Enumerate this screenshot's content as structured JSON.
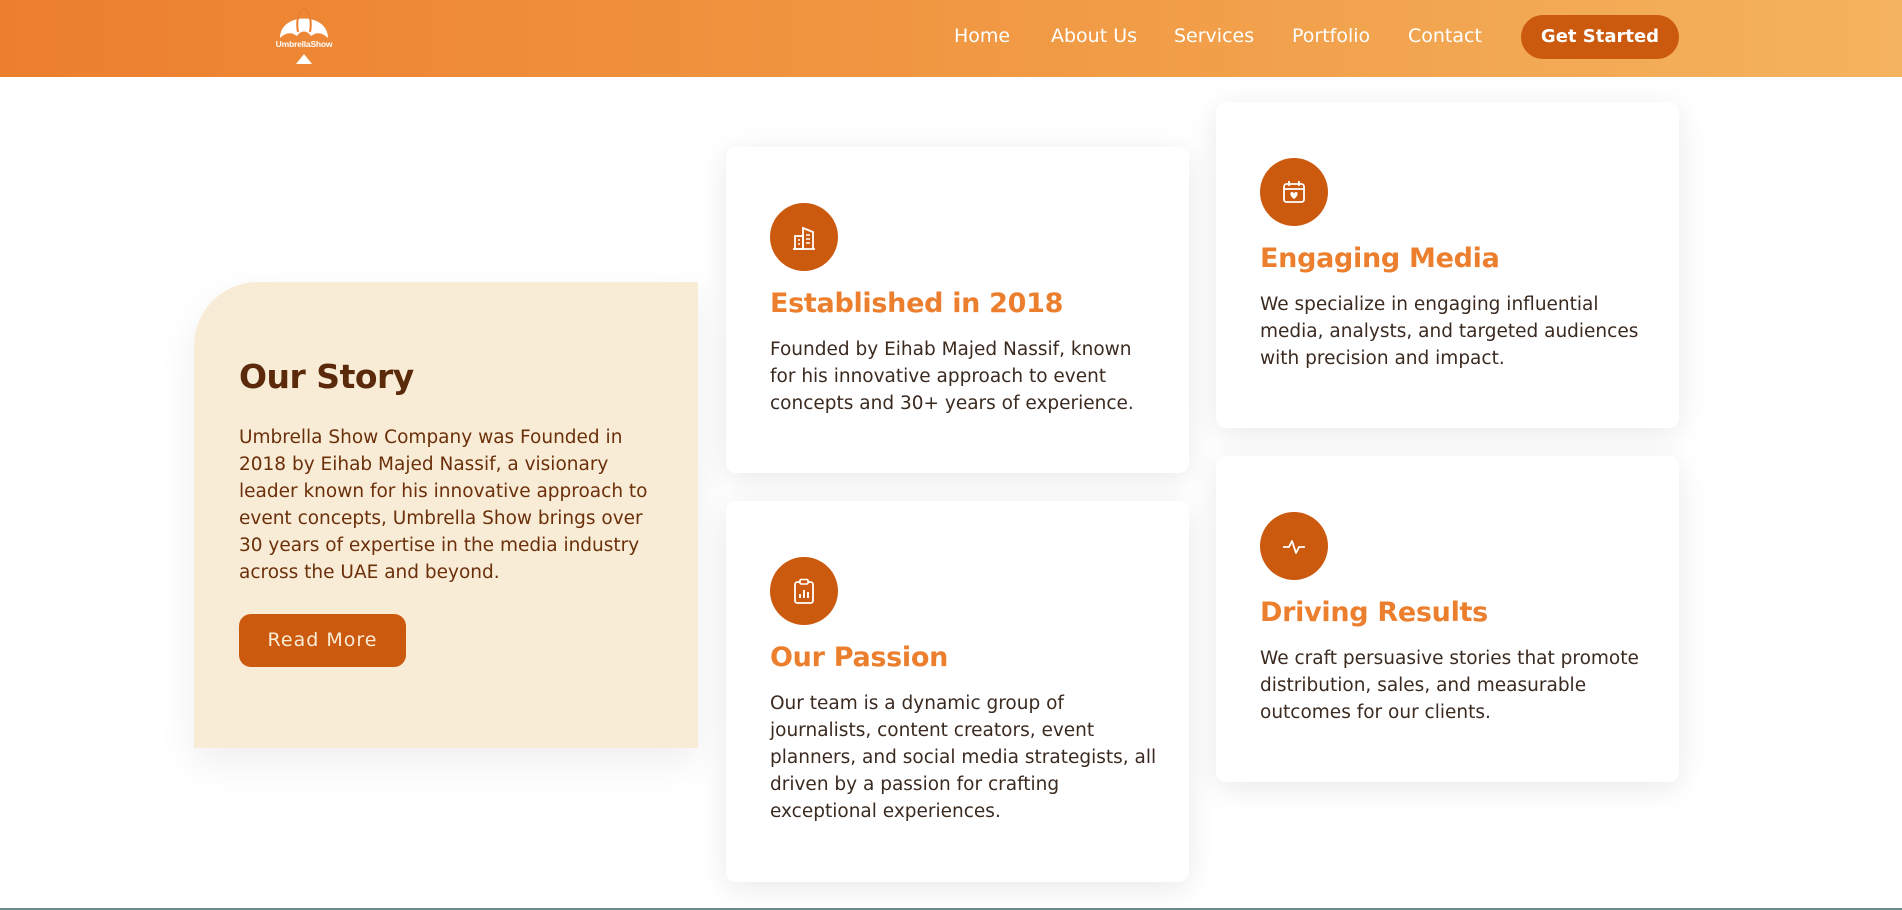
{
  "header": {
    "logo_text": "UmbrellaShow",
    "nav": [
      {
        "label": "Home"
      },
      {
        "label": "About Us"
      },
      {
        "label": "Services"
      },
      {
        "label": "Portfolio"
      },
      {
        "label": "Contact"
      }
    ],
    "cta_label": "Get Started"
  },
  "story": {
    "title": "Our Story",
    "text": "Umbrella Show Company was Founded in 2018 by Eihab Majed Nassif, a visionary leader known for his innovative approach to event concepts, Umbrella Show brings over 30 years of expertise in the media industry across the UAE and beyond.",
    "button_label": "Read More"
  },
  "cards": [
    {
      "icon": "building-icon",
      "title": "Established in 2018",
      "text": "Founded by Eihab Majed Nassif, known for his innovative approach to event concepts and 30+ years of experience."
    },
    {
      "icon": "calendar-heart-icon",
      "title": "Engaging Media",
      "text": "We specialize in engaging influential media, analysts, and targeted audiences with precision and impact."
    },
    {
      "icon": "clipboard-chart-icon",
      "title": "Our Passion",
      "text": "Our team is a dynamic group of journalists, content creators, event planners, and social media strategists, all driven by a passion for crafting exceptional experiences."
    },
    {
      "icon": "activity-icon",
      "title": "Driving Results",
      "text": "We craft persuasive stories that promote distribution, sales, and measurable outcomes for our clients."
    }
  ],
  "colors": {
    "accent": "#cc5a0e",
    "heading_orange": "#ec7f2e",
    "story_bg": "#f9ecd6",
    "header_gradient_start": "#ec7f2e",
    "header_gradient_end": "#f4b35e"
  }
}
